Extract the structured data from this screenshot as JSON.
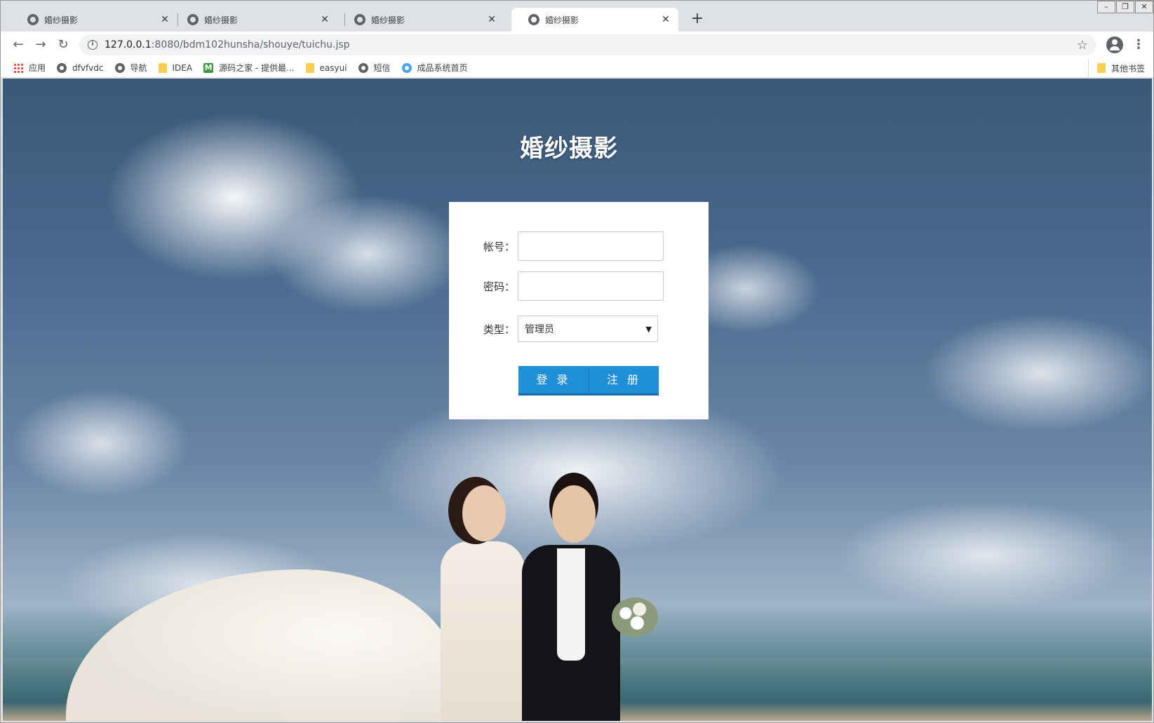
{
  "browser": {
    "tabs": [
      {
        "title": "婚纱摄影",
        "active": false
      },
      {
        "title": "婚纱摄影",
        "active": false
      },
      {
        "title": "婚纱摄影",
        "active": false
      },
      {
        "title": "婚纱摄影",
        "active": true
      }
    ],
    "new_tab_label": "+",
    "close_glyph": "✕",
    "url_host": "127.0.0.1",
    "url_rest": ":8080/bdm102hunsha/shouye/tuichu.jsp",
    "bookmarks": [
      {
        "label": "应用",
        "icon": "apps-grid-icon"
      },
      {
        "label": "dfvfvdc",
        "icon": "globe-icon"
      },
      {
        "label": "导航",
        "icon": "globe-icon"
      },
      {
        "label": "IDEA",
        "icon": "folder-icon"
      },
      {
        "label": "源码之家 - 提供最...",
        "icon": "m-logo-icon"
      },
      {
        "label": "easyui",
        "icon": "folder-icon"
      },
      {
        "label": "短信",
        "icon": "globe-icon"
      },
      {
        "label": "成品系统首页",
        "icon": "blue-circle-icon"
      }
    ],
    "other_bookmarks": "其他书签"
  },
  "page": {
    "title": "婚纱摄影",
    "form": {
      "account_label": "帐号：",
      "account_value": "",
      "password_label": "密码：",
      "password_value": "",
      "type_label": "类型：",
      "type_selected": "管理员",
      "login_button": "登 录",
      "register_button": "注 册"
    }
  },
  "colors": {
    "button_primary": "#1f8fd8",
    "card_background": "#ffffff"
  }
}
